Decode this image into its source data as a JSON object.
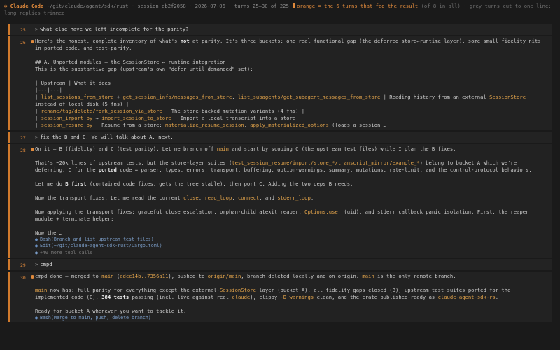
{
  "header": {
    "brand": "✻ Claude Code",
    "path": "~/git/claude/agent/sdk/rust",
    "session": "session eb2f2058",
    "date": "2026-07-06",
    "turns": "turns 25–30 of 225",
    "legend_orange": "orange = the 6 turns that fed the result",
    "legend_count": "(of 8 in all)",
    "legend_grey": "grey turns cut to one line; long replies trimmed"
  },
  "turns": [
    {
      "num": "25",
      "text": "what else have we left incomplete for the parity?"
    },
    {
      "num": "26",
      "intro_a": "Here's the honest, complete inventory of what's ",
      "intro_b": "not",
      "intro_c": " at parity. It's three buckets: one real functional gap (the deferred store↔runtime layer), some small fidelity nits in ported code, and test-parity.",
      "heading": "## A. Unported modules — the SessionStore ↔ runtime integration",
      "sub": "This is the substantive gap (upstream's own \"defer until demanded\" set):",
      "table_head": "| Upstream | What it does |",
      "table_rule": "|---|---|",
      "r1_pre": "| ",
      "r1_c1": "list_sessions_from_store",
      "r1_c2": " + ",
      "r1_c3": "get_session_info/messages_from_store",
      "r1_c4": ", ",
      "r1_c5": "list_subagents/get_subagent_messages_from_store",
      "r1_c6": " | Reading history from an external ",
      "r1_c7": "SessionStore",
      "r1_c8": " instead of local disk (5 fns) |",
      "r2_pre": "| ",
      "r2_c1": "rename/tag/delete/fork_session_via_store",
      "r2_c2": " | The store-backed mutation variants (4 fns) |",
      "r3_pre": "| ",
      "r3_c1": "session_import.py",
      "r3_c2": " → ",
      "r3_c3": "import_session_to_store",
      "r3_c4": " | Import a local transcript into a store |",
      "r4_pre": "| ",
      "r4_c1": "session_resume.py",
      "r4_c2": " | Resume from a store: ",
      "r4_c3": "materialize_resume_session",
      "r4_c4": ", ",
      "r4_c5": "apply_materialized_options",
      "r4_c6": " (loads a session …"
    },
    {
      "num": "27",
      "text": "fix the B and C. We will talk about A, next."
    },
    {
      "num": "28",
      "l1_a": "On it — B (fidelity) and C (test parity). Let me branch off ",
      "l1_b": "main",
      "l1_c": " and start by scoping C (the upstream test files) while I plan the B fixes.",
      "l2_a": "That's ~20k lines of upstream tests, but the store-layer suites (",
      "l2_b": "test_session_resume/import/store_*/transcript_mirror/example_*",
      "l2_c": ") belong to bucket A which we're deferring. C for the ",
      "l2_d": "ported",
      "l2_e": " code = parser, types, errors, transport, buffering, option-warnings, summary, mutations, rate-limit, and the control-protocol behaviors.",
      "l3_a": "Let me do ",
      "l3_b": "B first",
      "l3_c": " (contained code fixes, gets the tree stable), then port C. Adding the two deps B needs.",
      "l4_a": "Now the transport fixes. Let me read the current ",
      "l4_b": "close",
      "l4_c": ", ",
      "l4_d": "read_loop",
      "l4_e": ", ",
      "l4_f": "connect",
      "l4_g": ", and ",
      "l4_h": "stderr_loop",
      "l4_i": ".",
      "l5_a": "Now applying the transport fixes: graceful close escalation, orphan-child atexit reaper, ",
      "l5_b": "Options.user",
      "l5_c": " (uid), and stderr callback panic isolation. First, the reaper module + terminate helper:",
      "l6": "Now the …",
      "tool1": "Bash(Branch and list upstream test files)",
      "tool2": "Edit(~/git/claude-agent-sdk-rust/Cargo.toml)",
      "more": "+40 more tool calls"
    },
    {
      "num": "29",
      "text": "cmpd"
    },
    {
      "num": "30",
      "l1_a": "cmpd done — merged to ",
      "l1_b": "main",
      "l1_c": " (",
      "l1_d": "adcc14b..7356a11",
      "l1_e": "), pushed to ",
      "l1_f": "origin/main",
      "l1_g": ", branch deleted locally and on origin. ",
      "l1_h": "main",
      "l1_i": " is the only remote branch.",
      "l2_a": "main",
      "l2_b": " now has: full parity for everything except the external-",
      "l2_c": "SessionStore",
      "l2_d": " layer (bucket A), all fidelity gaps closed (B), upstream test suites ported for the implemented code (C), ",
      "l2_e": "384 tests",
      "l2_f": " passing (incl. live against real ",
      "l2_g": "claude",
      "l2_h": "), clippy ",
      "l2_i": "-D warnings",
      "l2_j": " clean, and the crate published-ready as ",
      "l2_k": "claude-agent-sdk-rs",
      "l2_l": ".",
      "l3": "Ready for bucket A whenever you want to tackle it.",
      "tool1": "Bash(Merge to main, push, delete branch)"
    }
  ]
}
